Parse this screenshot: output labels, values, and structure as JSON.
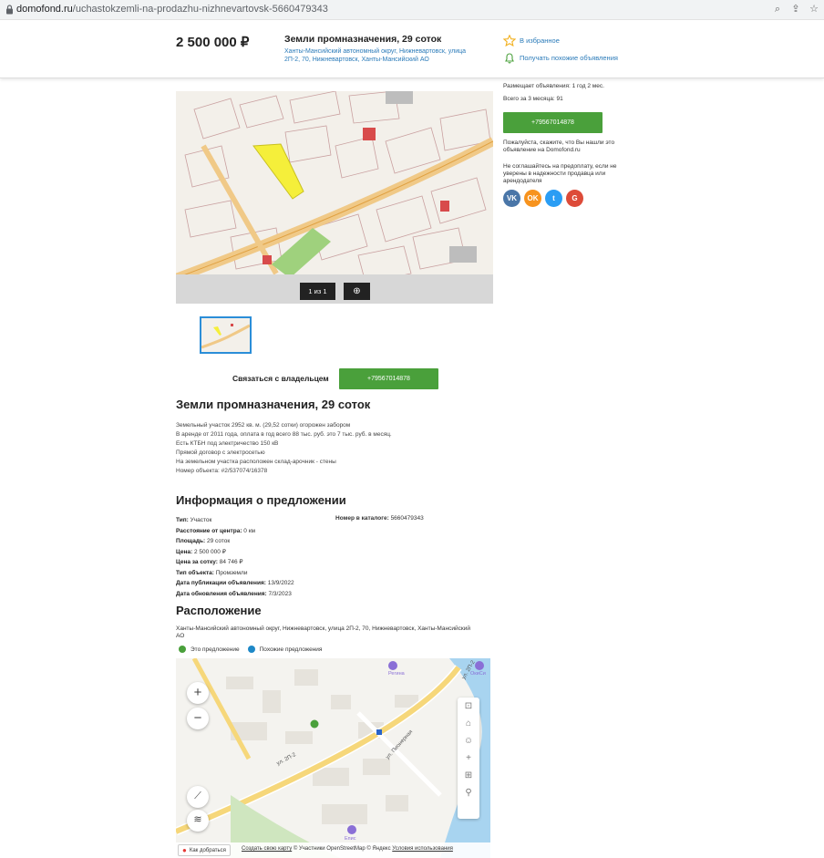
{
  "browser": {
    "url_domain": "domofond.ru",
    "url_path": "/uchastokzemli-na-prodazhu-nizhnevartovsk-5660479343"
  },
  "header": {
    "price": "2 500 000 ₽",
    "title": "Земли промназначения, 29 соток",
    "address": "Ханты-Мансийский автономный округ, Нижневартовск, улица 2П-2, 70, Нижневартовск, Ханты-Мансийский АО",
    "favorite_label": "В избранное",
    "subscribe_label": "Получать похожие объявления"
  },
  "seller": {
    "posting_since": "Размещает объявления: 1 год 2 мес.",
    "total_3_months": "Всего за 3 месяца: 91",
    "phone": "+79567014878",
    "mention_hint": "Пожалуйста, скажите, что Вы нашли это объявление на Domofond.ru",
    "prepay_warning": "Не соглашайтесь на предоплату, если не уверены в надежности продавца или арендодателя",
    "socials": [
      {
        "icon": "vk-icon",
        "label": "VK",
        "color": "#4a76a8"
      },
      {
        "icon": "ok-icon",
        "label": "OK",
        "color": "#f7931e"
      },
      {
        "icon": "twitter-icon",
        "label": "t",
        "color": "#2a9df4"
      },
      {
        "icon": "google-icon",
        "label": "G",
        "color": "#dd4b39"
      }
    ]
  },
  "gallery": {
    "counter": "1 из 1",
    "zoom_icon": "magnifier-icon"
  },
  "contact": {
    "label": "Связаться с владельцем",
    "phone": "+79567014878"
  },
  "description": {
    "title": "Земли промназначения, 29 соток",
    "lines": [
      "Земельный участок 2952 кв. м. (29,52 сотки) огорожен забором",
      "В аренде от 2011 года, оплата в год всего 88 тыс. руб. это 7 тыс. руб. в месяц.",
      "Есть КТБН под электричество 150 кВ",
      "Прямой договор с электросетью",
      "На земельном участка расположен склад-арочник - стены",
      "Номер объекта: #2/537074/16378"
    ]
  },
  "offer_info": {
    "title": "Информация о предложении",
    "rows": [
      {
        "label": "Тип:",
        "value": "Участок"
      },
      {
        "label": "Расстояние от центра:",
        "value": "0 км"
      },
      {
        "label": "Площадь:",
        "value": "29 соток"
      },
      {
        "label": "Цена:",
        "value": "2 500 000 ₽"
      },
      {
        "label": "Цена за сотку:",
        "value": "84 746 ₽"
      },
      {
        "label": "Тип объекта:",
        "value": "Промземли"
      },
      {
        "label": "Дата публикации объявления:",
        "value": "13/9/2022"
      },
      {
        "label": "Дата обновления объявления:",
        "value": "7/3/2023"
      }
    ],
    "catalog_label": "Номер в каталоге:",
    "catalog_value": "5660479343"
  },
  "location": {
    "title": "Расположение",
    "address": "Ханты-Мансийский автономный округ, Нижневартовск, улица 2П-2, 70, Нижневартовск, Ханты-Мансийский АО",
    "legend_this": "Это предложение",
    "legend_similar": "Похожие предложения",
    "legend_this_color": "#4aa03b",
    "legend_similar_color": "#1e88c7",
    "map_labels": {
      "street_1": "ул. 2П-2",
      "street_2": "ул. Пионерная",
      "street_3": "ул. 2П-2",
      "poi_1": "Регина",
      "poi_2": "ОкиСи",
      "poi_3": "Епис"
    },
    "route_label": "Как добраться",
    "create_map": "Создать свою карту",
    "attribution": "© Участники OpenStreetMap © Яндекс",
    "terms": "Условия использования"
  }
}
